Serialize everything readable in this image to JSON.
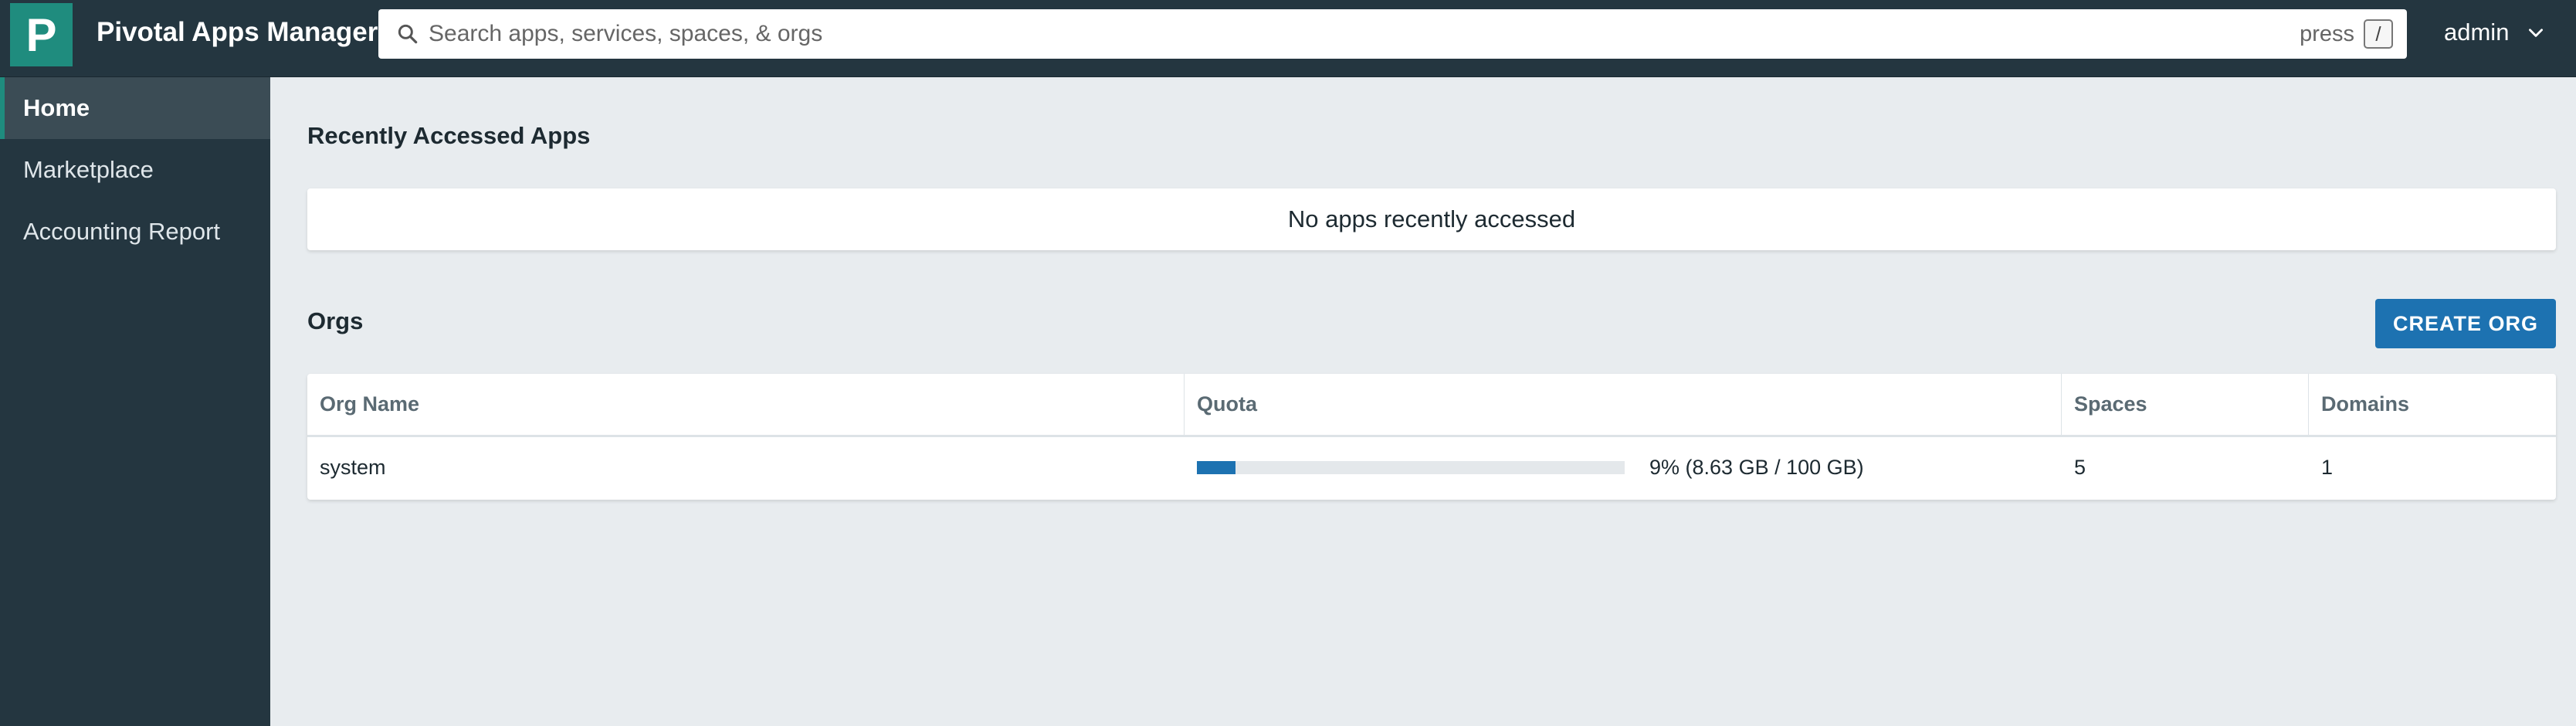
{
  "header": {
    "logo_letter": "P",
    "app_title": "Pivotal Apps Manager",
    "search_placeholder": "Search apps, services, spaces, & orgs",
    "press_label": "press",
    "shortcut_key": "/",
    "user_name": "admin"
  },
  "sidebar": {
    "items": [
      {
        "label": "Home",
        "active": true
      },
      {
        "label": "Marketplace",
        "active": false
      },
      {
        "label": "Accounting Report",
        "active": false
      }
    ]
  },
  "recent_apps": {
    "title": "Recently Accessed Apps",
    "empty_message": "No apps recently accessed"
  },
  "orgs": {
    "title": "Orgs",
    "create_button": "CREATE ORG",
    "columns": [
      "Org Name",
      "Quota",
      "Spaces",
      "Domains"
    ],
    "rows": [
      {
        "name": "system",
        "quota_fraction": 0.09,
        "quota_text": "9% (8.63 GB / 100 GB)",
        "spaces": "5",
        "domains": "1"
      }
    ]
  },
  "colors": {
    "topbar": "#243640",
    "brand_accent": "#1f8c7e",
    "primary_button": "#1d72b1"
  }
}
